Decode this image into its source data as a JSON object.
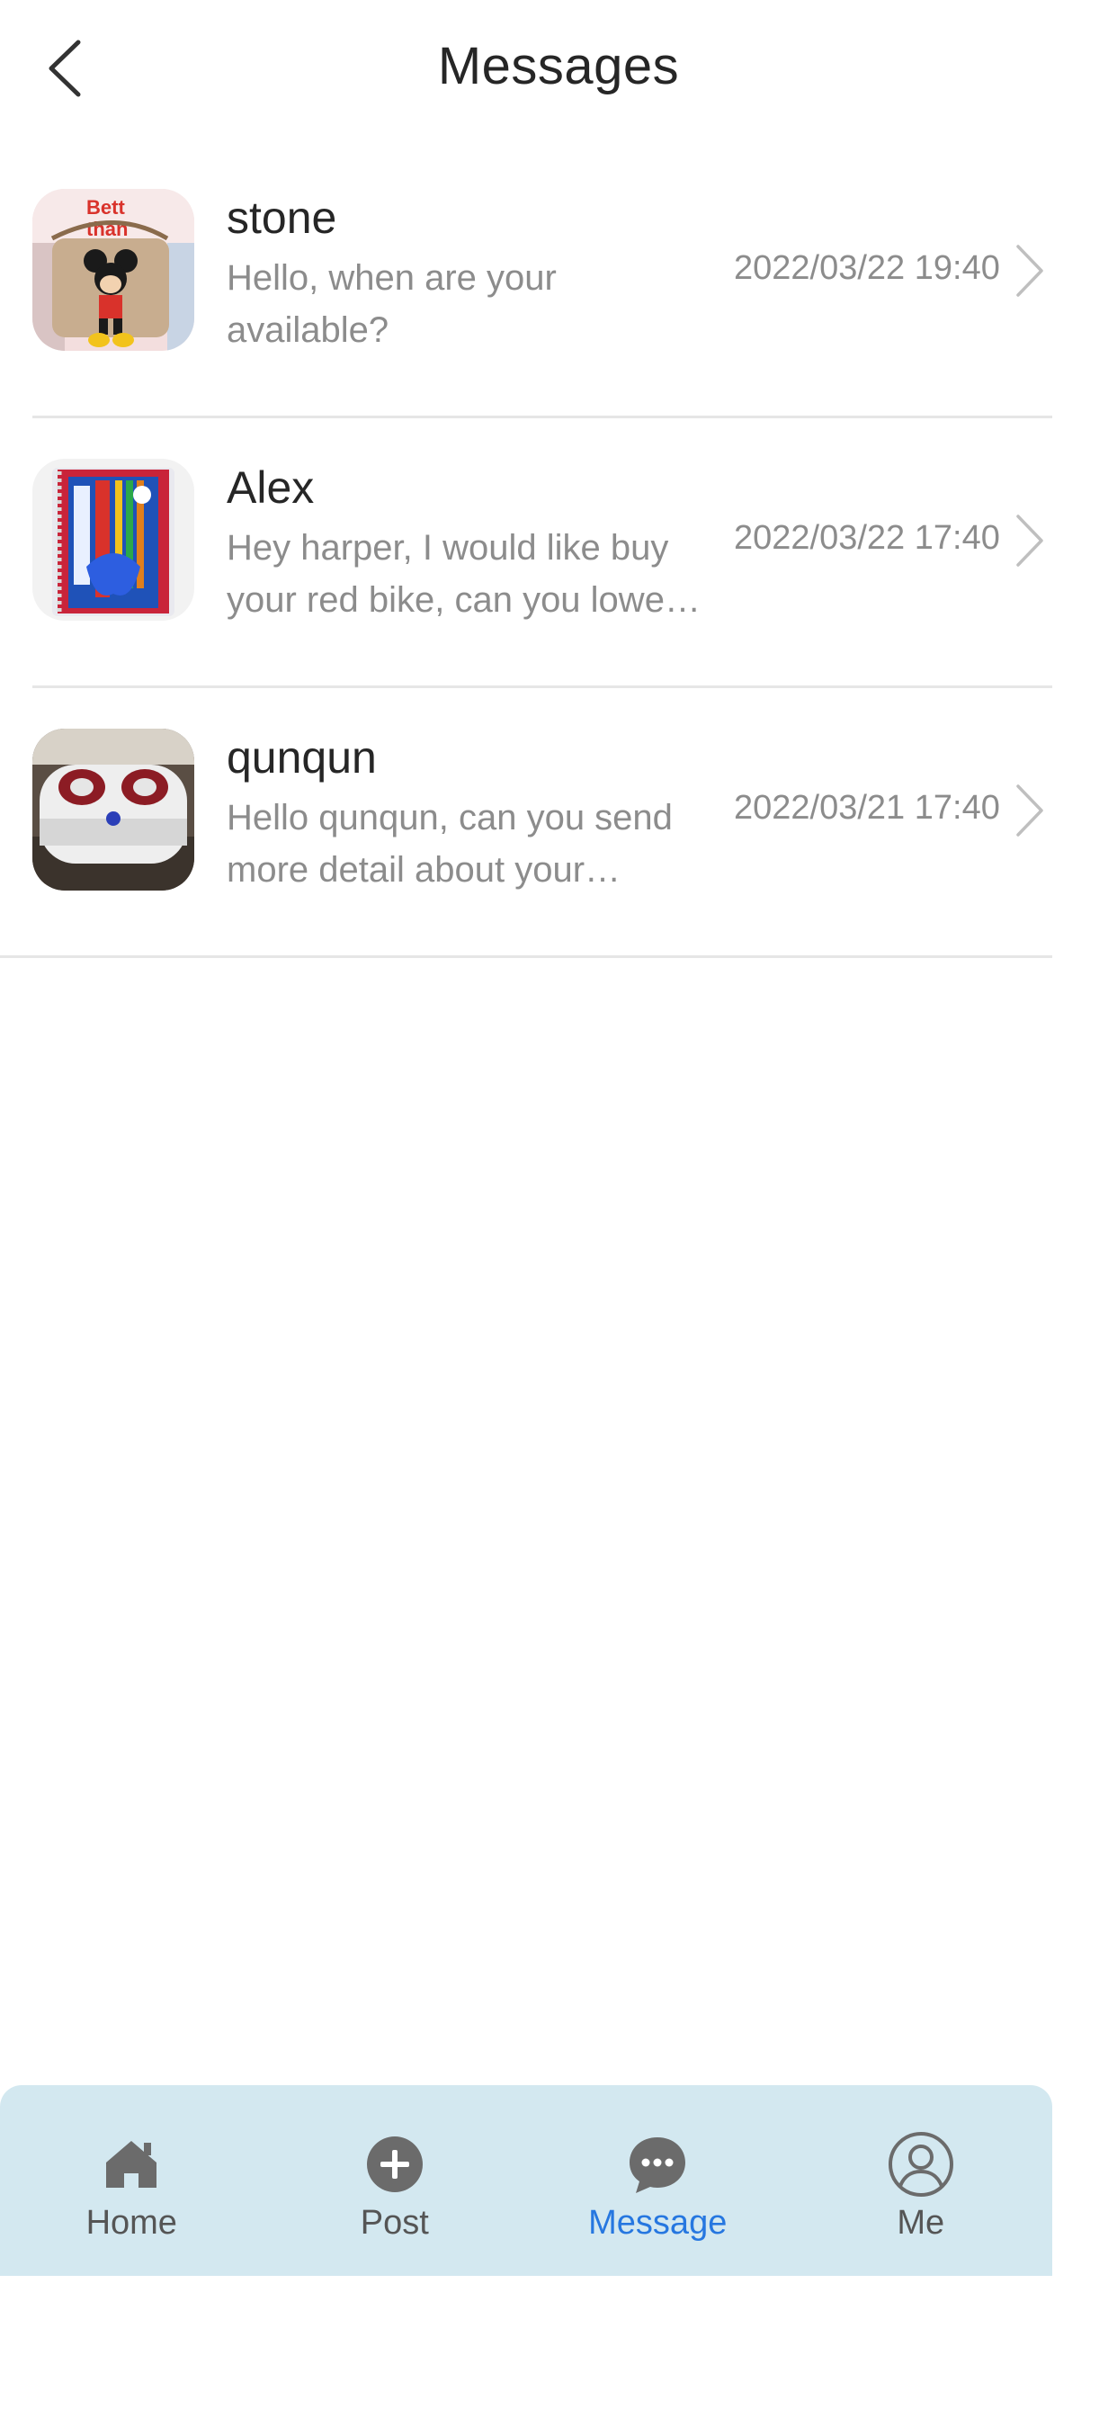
{
  "header": {
    "title": "Messages",
    "back_icon": "chevron-left-icon"
  },
  "messages": [
    {
      "name": "stone",
      "preview": "Hello, when are your available?",
      "time": "2022/03/22 19:40",
      "avatar": "product-photo-mickey-tote-bag"
    },
    {
      "name": "Alex",
      "preview": "Hey harper, I would like buy your red bike, can you lower the price?",
      "time": "2022/03/22 17:40",
      "avatar": "product-photo-notebook-and-pens"
    },
    {
      "name": "qunqun",
      "preview": "Hello qunqun, can you send more detail about your product?",
      "time": "2022/03/21 17:40",
      "avatar": "product-photo-foot-massager"
    }
  ],
  "tabbar": {
    "active": "Message",
    "active_color": "#2677e0",
    "inactive_color": "#555555",
    "background": "#d3e8f0",
    "items": [
      {
        "label": "Home",
        "icon": "home-icon"
      },
      {
        "label": "Post",
        "icon": "plus-circle-icon"
      },
      {
        "label": "Message",
        "icon": "chat-bubble-icon"
      },
      {
        "label": "Me",
        "icon": "user-circle-icon"
      }
    ]
  }
}
